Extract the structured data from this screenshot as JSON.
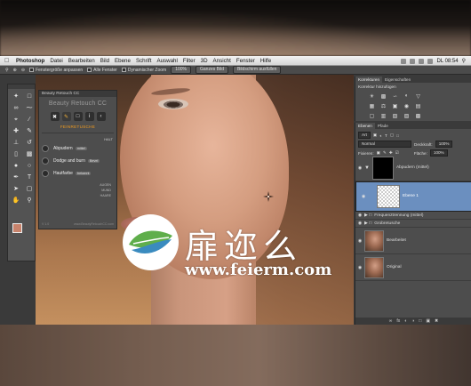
{
  "menubar": {
    "app": "Photoshop",
    "items": [
      "Datei",
      "Bearbeiten",
      "Bild",
      "Ebene",
      "Schrift",
      "Auswahl",
      "Filter",
      "3D",
      "Ansicht",
      "Fenster",
      "Hilfe"
    ],
    "clock": "DL 08:54"
  },
  "options_bar": {
    "resize_label": "Fenstergröße anpassen",
    "all_windows": "Alle Fenster",
    "dynamic_zoom": "Dynamischer Zoom",
    "zoom": "100%",
    "fit_button": "Ganzes Bild",
    "fill_button": "Bildschirm ausfüllen"
  },
  "beauty_panel": {
    "header": "Beauty Retouch CC",
    "title": "Beauty Retouch CC",
    "tab": "FEINRETUSCHE",
    "halt": "HALT",
    "rows": [
      {
        "label": "Abpudern",
        "pill": "mittel"
      },
      {
        "label": "Dodge and burn",
        "pill": "Bevel"
      },
      {
        "label": "Hautfarbe",
        "pill": "bekannt"
      }
    ],
    "options": [
      "AUGEN",
      "MUND",
      "HAARE"
    ],
    "footer_left": "V 1.0",
    "footer_right": "www.BeautyRetouchCC.com"
  },
  "korrekturen": {
    "tab1": "Korrekturen",
    "tab2": "Eigenschaften",
    "sub": "Korrektur hinzufügen"
  },
  "layers_panel": {
    "tab1": "Ebenen",
    "tab2": "Pfade",
    "kind": "Art",
    "mode": "Normal",
    "opacity_label": "Deckkraft:",
    "opacity_value": "100%",
    "lock_label": "Fixieren:",
    "fill_label": "Fläche:",
    "fill_value": "100%",
    "layers": [
      {
        "name": "Abpudern (mittel)"
      },
      {
        "name": "Ebene 1"
      },
      {
        "name": "Frequenztrennung (mittel)"
      },
      {
        "name": "Grobretusche"
      },
      {
        "name": "Bearbeitet"
      },
      {
        "name": "Original"
      }
    ]
  },
  "watermark": {
    "chinese": "扉迩么",
    "url": "www.feierm.com"
  },
  "colors": {
    "foreground": "#c8836c",
    "background": "#ffffff",
    "accent": "#f29c1f",
    "selection": "#6b8fbf"
  }
}
